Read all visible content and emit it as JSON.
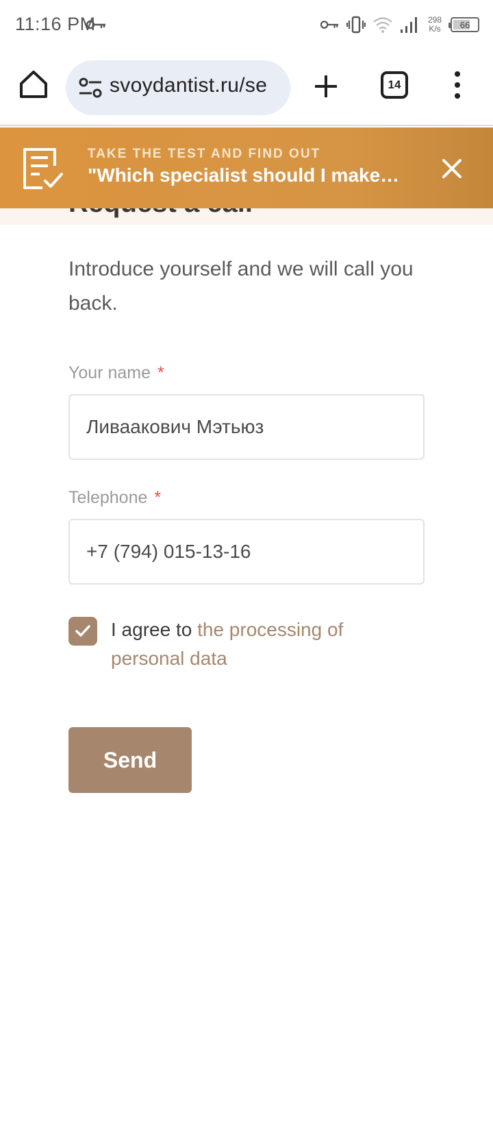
{
  "status_bar": {
    "time": "11:16 PM",
    "net_speed_value": "298",
    "net_speed_unit": "K/s",
    "battery_level": "66",
    "icons": [
      "vpn-key-icon",
      "vpn-key-icon",
      "vibrate-icon",
      "wifi-icon",
      "signal-icon",
      "battery-icon"
    ]
  },
  "browser": {
    "url": "svoydantist.ru/se",
    "tab_count": "14",
    "icons": [
      "home-icon",
      "tune-icon",
      "plus-icon",
      "tabs-icon",
      "more-vert-icon"
    ]
  },
  "page": {
    "peek_heading": "Request a call",
    "banner": {
      "kicker": "TAKE THE TEST AND FIND OUT",
      "headline": "\"Which specialist should I make an appointment with?\"",
      "icons": [
        "document-check-icon",
        "close-icon"
      ]
    },
    "intro": "Introduce yourself and we will call you back.",
    "form": {
      "name_label": "Your name",
      "name_value": "Ливаакович Мэтьюз",
      "phone_label": "Telephone",
      "phone_value": "+7 (794) 015-13-16",
      "required_mark": "*",
      "consent_prefix": "I agree to",
      "consent_link": "the processing of personal data",
      "consent_checked": true,
      "send_label": "Send"
    },
    "colors": {
      "accent": "#a6866c",
      "banner": "#d69544",
      "required": "#e0504e"
    }
  }
}
